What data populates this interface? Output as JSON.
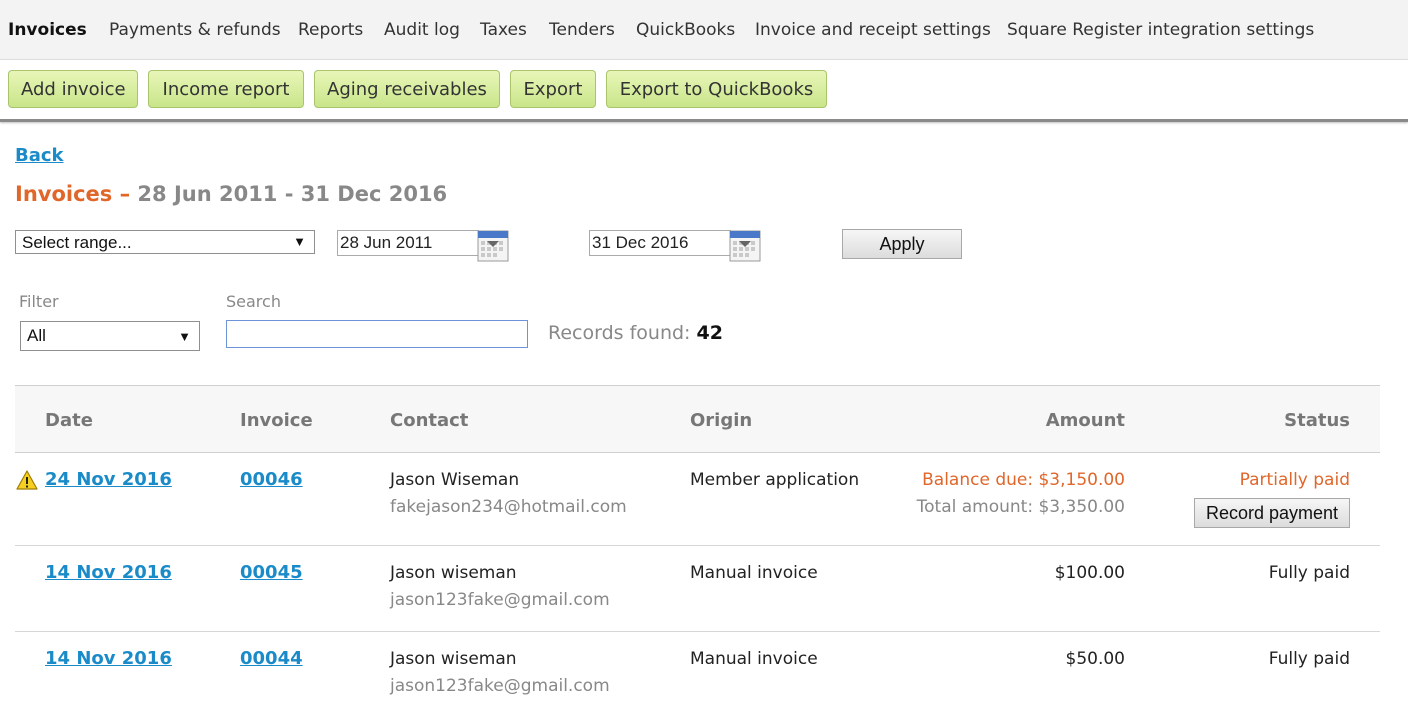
{
  "topnav": {
    "tabs": [
      {
        "label": "Invoices",
        "active": true
      },
      {
        "label": "Payments & refunds"
      },
      {
        "label": "Reports"
      },
      {
        "label": "Audit log"
      },
      {
        "label": "Taxes"
      },
      {
        "label": "Tenders"
      },
      {
        "label": "QuickBooks"
      },
      {
        "label": "Invoice and receipt settings"
      },
      {
        "label": "Square Register integration settings"
      }
    ]
  },
  "toolbar": {
    "buttons": [
      {
        "label": "Add invoice"
      },
      {
        "label": "Income report"
      },
      {
        "label": "Aging receivables"
      },
      {
        "label": "Export"
      },
      {
        "label": "Export to QuickBooks"
      }
    ]
  },
  "back_label": "Back",
  "heading": {
    "title": "Invoices",
    "dash": "–",
    "range": "28 Jun 2011 - 31 Dec 2016"
  },
  "range_select": {
    "value": "Select range...",
    "arrow": "▼"
  },
  "date_from": "28 Jun 2011",
  "date_to": "31 Dec 2016",
  "apply_label": "Apply",
  "filter": {
    "label": "Filter",
    "value": "All",
    "arrow": "▼"
  },
  "search": {
    "label": "Search",
    "value": ""
  },
  "records": {
    "label": "Records found:",
    "count": "42"
  },
  "table": {
    "headers": {
      "date": "Date",
      "invoice": "Invoice",
      "contact": "Contact",
      "origin": "Origin",
      "amount": "Amount",
      "status": "Status"
    },
    "rows": [
      {
        "date": "24 Nov 2016",
        "invoice": "00046",
        "contact_name": "Jason Wiseman",
        "contact_email": "fakejason234@hotmail.com",
        "origin": "Member application",
        "amount_primary": "Balance due: $3,150.00",
        "amount_secondary": "Total amount: $3,350.00",
        "status": "Partially paid",
        "action": "Record payment",
        "warning": true
      },
      {
        "date": "14 Nov 2016",
        "invoice": "00045",
        "contact_name": "Jason wiseman",
        "contact_email": "jason123fake@gmail.com",
        "origin": "Manual invoice",
        "amount_primary": "$100.00",
        "status": "Fully paid"
      },
      {
        "date": "14 Nov 2016",
        "invoice": "00044",
        "contact_name": "Jason wiseman",
        "contact_email": "jason123fake@gmail.com",
        "origin": "Manual invoice",
        "amount_primary": "$50.00",
        "status": "Fully paid"
      }
    ]
  },
  "colors": {
    "accent_orange": "#e0662a",
    "link_blue": "#1a8bc8",
    "button_green": "#c9e58a"
  }
}
